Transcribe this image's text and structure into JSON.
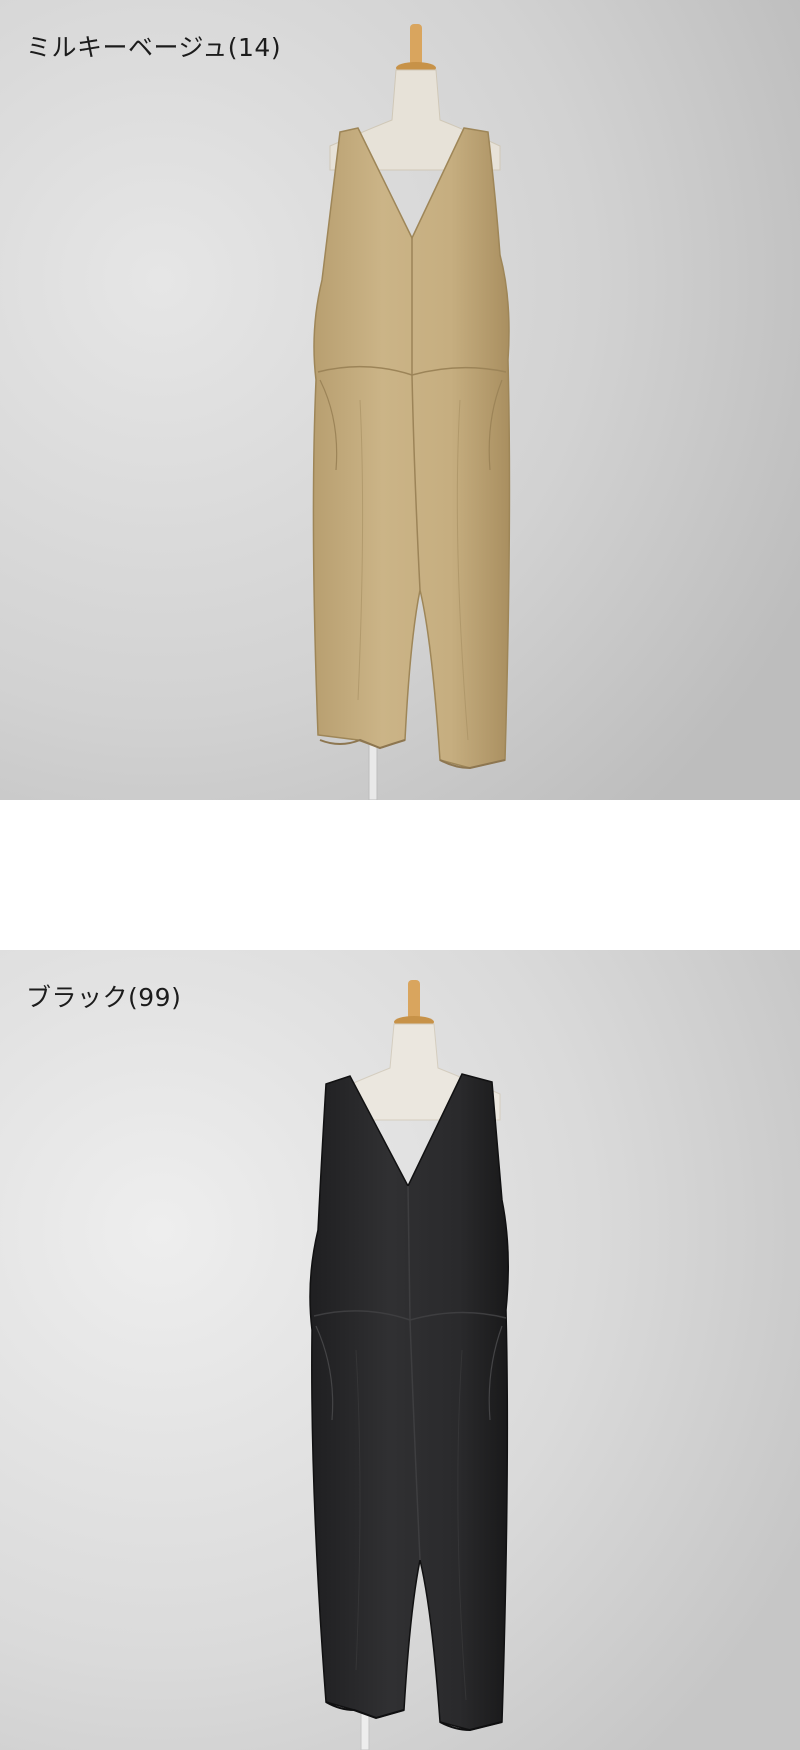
{
  "variants": [
    {
      "label": "ミルキーベージュ(14)",
      "garment_color": "#c8b183",
      "garment_shade": "#a89062",
      "garment_stitch": "#9c8458",
      "background": "#cfcfcf"
    },
    {
      "label": "ブラック(99)",
      "garment_color": "#2b2b2d",
      "garment_shade": "#1b1b1c",
      "garment_stitch": "#3e3e40",
      "background": "#d8d8d8"
    }
  ]
}
